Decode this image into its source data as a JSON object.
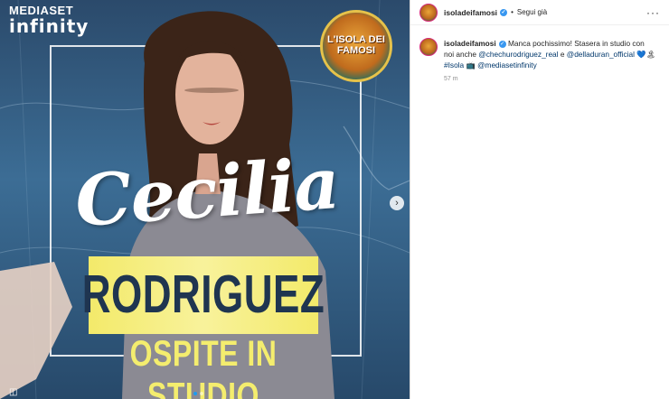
{
  "media": {
    "brand_top": "MEDIASET",
    "brand_bottom": "infinity",
    "badge_text": "L'ISOLA DEI FAMOSI",
    "name_first": "Cecilia",
    "name_last": "RODRIGUEZ",
    "tagline": "OSPITE IN STUDIO",
    "next_icon": "›"
  },
  "post": {
    "username": "isoladeifamosi",
    "separator": "•",
    "follow_label": "Segui già",
    "more_icon": "···",
    "caption_user": "isoladeifamosi",
    "caption_text_1": "Manca pochissimo! Stasera in studio con noi anche",
    "mention_1": "@chechurodriguez_real",
    "caption_text_2": "e",
    "mention_2": "@delladuran_official",
    "emojis": "💙🏝",
    "hashtag": "#Isola",
    "emoji_2": "📺",
    "mention_3": "@mediasetinfinity",
    "time": "57 m"
  },
  "colors": {
    "verified": "#3897f0",
    "link": "#00376b",
    "accent_yellow": "#f4ed6e"
  }
}
